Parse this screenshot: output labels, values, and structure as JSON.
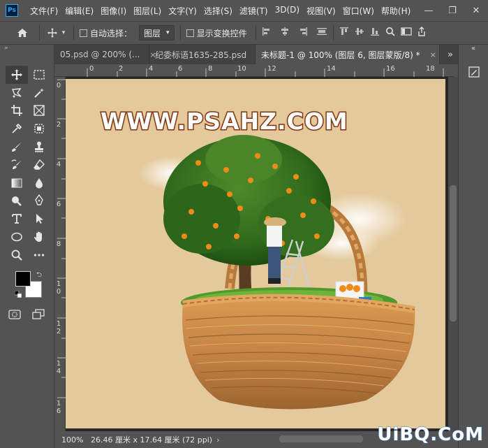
{
  "app": {
    "logo": "Ps"
  },
  "menu": [
    "文件(F)",
    "编辑(E)",
    "图像(I)",
    "图层(L)",
    "文字(Y)",
    "选择(S)",
    "滤镜(T)",
    "3D(D)",
    "视图(V)",
    "窗口(W)",
    "帮助(H)"
  ],
  "window_controls": {
    "minimize": "—",
    "maximize": "❐",
    "close": "✕"
  },
  "options": {
    "auto_select_label": "自动选择：",
    "auto_select_value": "图层",
    "show_transform_label": "显示变换控件"
  },
  "tabs": [
    {
      "label": "05.psd @ 200% (...",
      "close": "×"
    },
    {
      "label": "纪委标语1635-285.psd",
      "close": "×"
    },
    {
      "label": "未标题-1 @ 100% (图层 6, 图层蒙版/8) *",
      "close": "×"
    }
  ],
  "tabs_more": "»",
  "ruler_h": [
    "0",
    "2",
    "4",
    "6",
    "8",
    "10",
    "12",
    "14",
    "16",
    "18"
  ],
  "ruler_v": [
    "0",
    "2",
    "4",
    "6",
    "8",
    "10",
    "12",
    "14",
    "16"
  ],
  "canvas": {
    "watermark_text": "WWW.PSAHZ.COM",
    "background": "#e3c99b"
  },
  "status": {
    "zoom": "100%",
    "doc_info": "26.46 厘米 x 17.64 厘米 (72 ppi)",
    "arrow": "›"
  },
  "site_watermark": "UiBQ.CoM",
  "colors": {
    "foreground": "#000000",
    "background": "#ffffff"
  }
}
